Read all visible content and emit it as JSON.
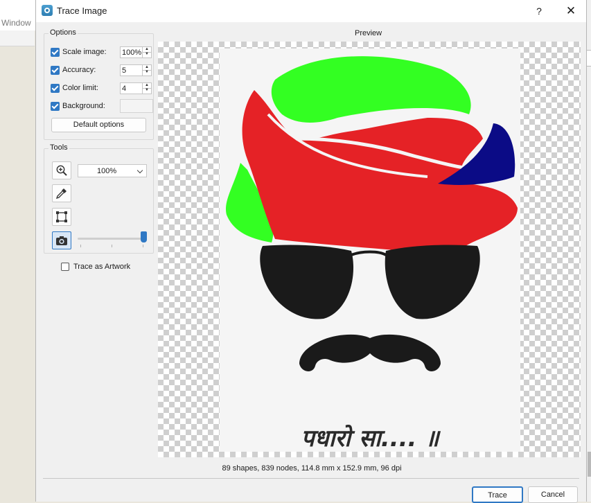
{
  "background_app": {
    "menu_item": "Window"
  },
  "dialog": {
    "title": "Trace Image",
    "help_glyph": "?",
    "close_glyph": "✕",
    "options": {
      "group_title": "Options",
      "scale_image": {
        "label": "Scale image:",
        "value": "100%",
        "checked": true
      },
      "accuracy": {
        "label": "Accuracy:",
        "value": "5",
        "checked": true
      },
      "color_limit": {
        "label": "Color limit:",
        "value": "4",
        "checked": true
      },
      "background": {
        "label": "Background:",
        "checked": true
      },
      "default_button": "Default options"
    },
    "tools": {
      "group_title": "Tools",
      "zoom_value": "100%",
      "icons": [
        "zoom-in-icon",
        "eyedropper-icon",
        "crop-frame-icon",
        "camera-icon"
      ],
      "slider_fraction": 1.0,
      "trace_as_artwork": {
        "label": "Trace as Artwork",
        "checked": false
      }
    },
    "preview": {
      "label": "Preview",
      "image_caption": "पधारो सा.... ॥",
      "colors": {
        "turban_green": "#33ff22",
        "turban_red": "#e52226",
        "turban_blue": "#0b0b86",
        "glasses": "#1a1a1a"
      }
    },
    "status": "89 shapes, 839 nodes, 114.8 mm x 152.9 mm, 96 dpi",
    "buttons": {
      "trace": "Trace",
      "cancel": "Cancel"
    }
  }
}
